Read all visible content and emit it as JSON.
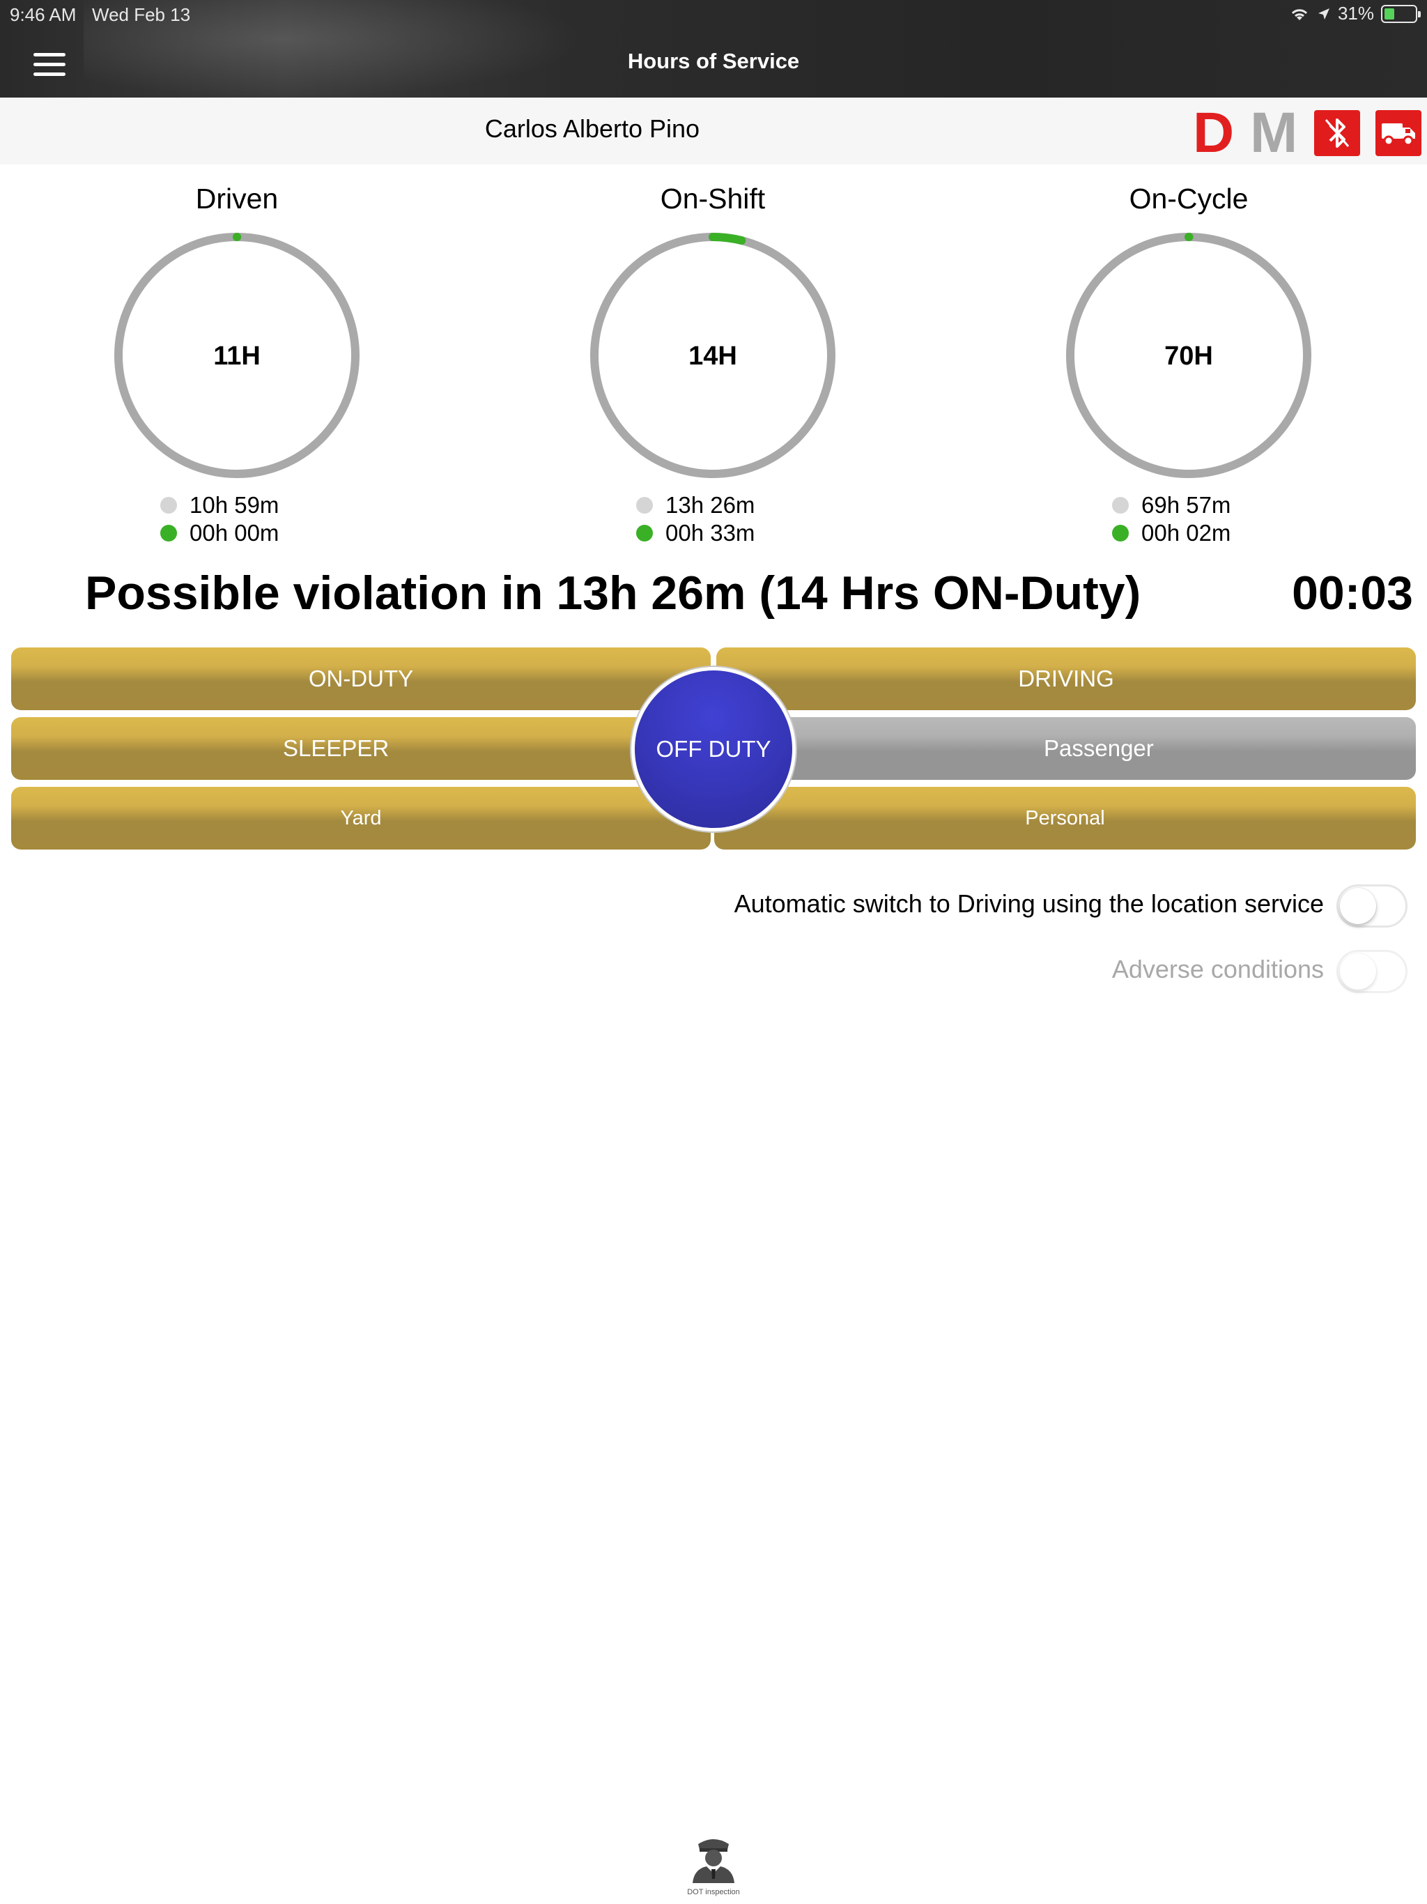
{
  "status_bar": {
    "time": "9:46 AM",
    "date": "Wed Feb 13",
    "battery": "31%"
  },
  "nav": {
    "title": "Hours of Service",
    "menu_icon": "hamburger-menu-icon"
  },
  "driver": {
    "name": "Carlos Alberto Pino",
    "status_letter_d": "D",
    "status_letter_m": "M",
    "bluetooth_icon": "bluetooth-off-icon",
    "truck_icon": "truck-icon",
    "alert_color": "#e11c1c"
  },
  "gauges": [
    {
      "title": "Driven",
      "center": "11H",
      "remaining": "10h 59m",
      "used": "00h 00m",
      "used_fraction": 0.0
    },
    {
      "title": "On-Shift",
      "center": "14H",
      "remaining": "13h 26m",
      "used": "00h 33m",
      "used_fraction": 0.039
    },
    {
      "title": "On-Cycle",
      "center": "70H",
      "remaining": "69h 57m",
      "used": "00h 02m",
      "used_fraction": 0.0005
    }
  ],
  "colors": {
    "ring": "#a9a9a9",
    "progress": "#3ab026",
    "gold": "#c9a947",
    "off_duty": "#3636b8"
  },
  "violation": {
    "message": "Possible violation in 13h 26m (14 Hrs ON-Duty)",
    "timer": "00:03"
  },
  "duty_buttons": {
    "on_duty": "ON-DUTY",
    "driving": "DRIVING",
    "sleeper": "SLEEPER",
    "off_duty": "OFF DUTY",
    "passenger": "Passenger",
    "yard": "Yard",
    "personal": "Personal",
    "selected": "OFF DUTY"
  },
  "toggles": {
    "auto_switch": {
      "label": "Automatic switch to Driving using the location service",
      "on": false
    },
    "adverse": {
      "label": "Adverse conditions",
      "on": false,
      "enabled": false
    }
  },
  "footer": {
    "dot_inspection_label": "DOT inspection",
    "dot_icon": "officer-icon"
  }
}
